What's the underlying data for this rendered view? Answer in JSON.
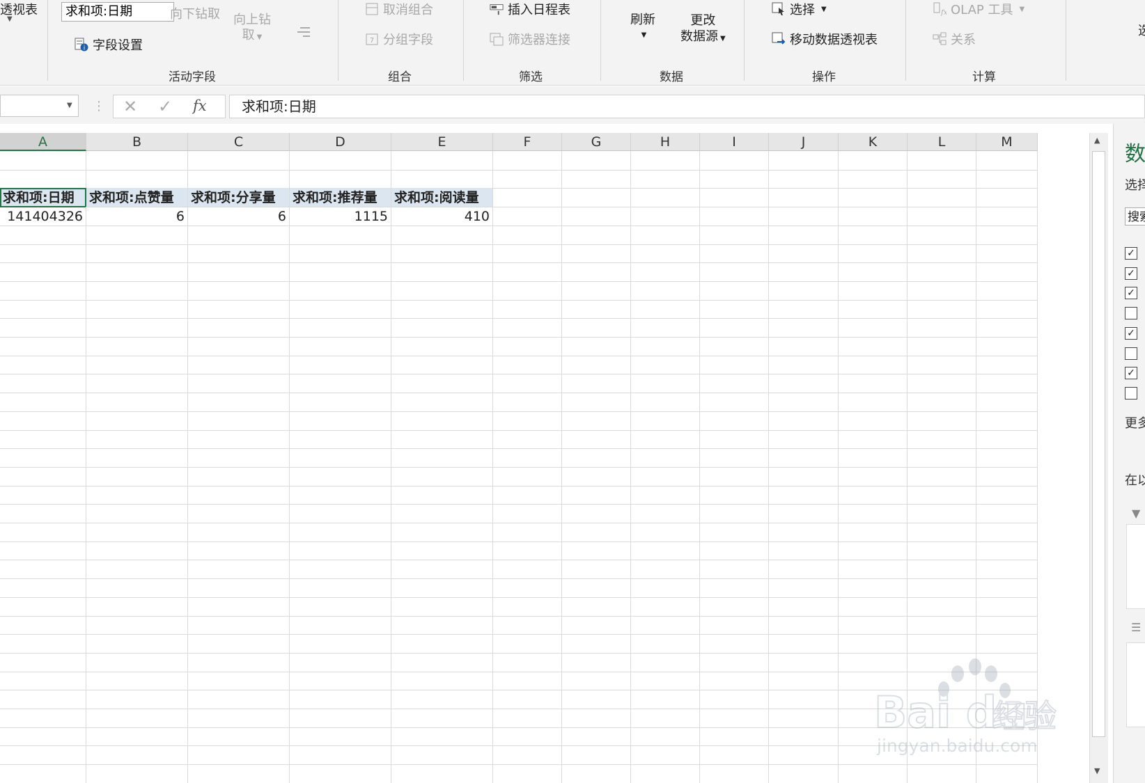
{
  "ribbon": {
    "groups": {
      "active_field": "活动字段",
      "group": "组合",
      "filter": "筛选",
      "data": "数据",
      "actions": "操作",
      "calculations": "计算"
    },
    "pivot_table_label": "透视表",
    "active_field_value": "求和项:日期",
    "drill_down": "向下钻取",
    "drill_up_line1": "向上钻",
    "drill_up_line2": "取",
    "field_settings": "字段设置",
    "ungroup": "取消组合",
    "group_field": "分组字段",
    "insert_timeline": "插入日程表",
    "filter_connections": "筛选器连接",
    "refresh": "刷新",
    "change_source_line1": "更改",
    "change_source_line2": "数据源",
    "select": "选择",
    "move_pivot": "移动数据透视表",
    "olap_tools": "OLAP 工具",
    "relationships": "关系",
    "edge_label": "选"
  },
  "formula_bar": {
    "name_box": "",
    "formula": "求和项:日期",
    "fx": "fx"
  },
  "grid": {
    "columns": [
      "A",
      "B",
      "C",
      "D",
      "E",
      "F",
      "G",
      "H",
      "I",
      "J",
      "K",
      "L",
      "M"
    ],
    "header_row": [
      "求和项:日期",
      "求和项:点赞量",
      "求和项:分享量",
      "求和项:推荐量",
      "求和项:阅读量"
    ],
    "value_row": [
      "141404326",
      "6",
      "6",
      "1115",
      "410"
    ]
  },
  "right_pane": {
    "title": "数",
    "choose": "选择",
    "search": "搜索",
    "checkboxes": [
      true,
      true,
      true,
      false,
      true,
      false,
      true,
      false
    ],
    "more": "更多",
    "drag": "在以"
  },
  "watermark": {
    "brand": "Baidu经验",
    "url": "jingyan.baidu.com"
  },
  "colors": {
    "accent": "#217346",
    "header_fill": "#dce6f1"
  }
}
